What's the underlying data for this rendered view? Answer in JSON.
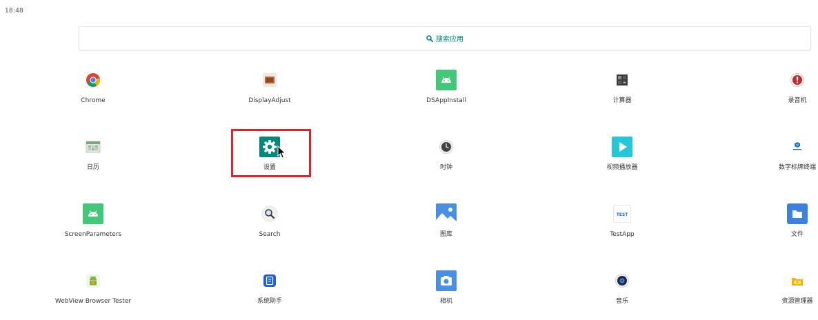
{
  "status_bar": {
    "time": "18:48"
  },
  "search": {
    "label": "搜索应用"
  },
  "apps": [
    {
      "id": "chrome",
      "label": "Chrome",
      "icon": "chrome-icon"
    },
    {
      "id": "displayadjust",
      "label": "DisplayAdjust",
      "icon": "display-adjust-icon"
    },
    {
      "id": "dsappinstall",
      "label": "DSAppInstall",
      "icon": "android-icon"
    },
    {
      "id": "calculator",
      "label": "计算器",
      "icon": "calculator-icon"
    },
    {
      "id": "recorder",
      "label": "录音机",
      "icon": "recorder-icon"
    },
    {
      "id": "calendar",
      "label": "日历",
      "icon": "calendar-icon"
    },
    {
      "id": "settings",
      "label": "设置",
      "icon": "settings-gear-icon",
      "selected": true
    },
    {
      "id": "clock",
      "label": "时钟",
      "icon": "clock-icon"
    },
    {
      "id": "videoplayer",
      "label": "视频播放器",
      "icon": "play-icon"
    },
    {
      "id": "signage",
      "label": "数字标牌终端",
      "icon": "signage-icon"
    },
    {
      "id": "screenparameters",
      "label": "ScreenParameters",
      "icon": "android-icon"
    },
    {
      "id": "search",
      "label": "Search",
      "icon": "magnifier-icon"
    },
    {
      "id": "gallery",
      "label": "图库",
      "icon": "gallery-icon"
    },
    {
      "id": "testapp",
      "label": "TestApp",
      "icon": "test-icon",
      "icon_text": "TEST"
    },
    {
      "id": "files",
      "label": "文件",
      "icon": "folder-icon"
    },
    {
      "id": "webviewtester",
      "label": "WebView Browser Tester",
      "icon": "android-robot-icon"
    },
    {
      "id": "systemhelper",
      "label": "系统助手",
      "icon": "system-helper-icon"
    },
    {
      "id": "camera",
      "label": "相机",
      "icon": "camera-icon"
    },
    {
      "id": "music",
      "label": "音乐",
      "icon": "music-icon"
    },
    {
      "id": "explorer",
      "label": "资源管理器",
      "icon": "file-explorer-icon"
    }
  ],
  "colors": {
    "accent": "#00897b",
    "selection": "#d9252b",
    "label": "#333333"
  }
}
